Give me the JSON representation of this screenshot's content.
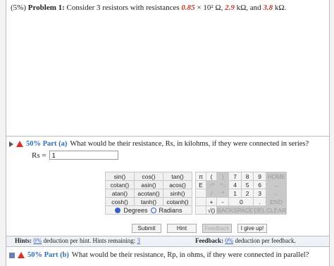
{
  "problem": {
    "weight": "(5%)",
    "label": "Problem 1:",
    "text_pre": "Consider 3 resistors with resistances",
    "r1": "0.85",
    "r1_unit": "× 10² Ω,",
    "r2": "2.9",
    "r2_unit": "kΩ, and",
    "r3": "3.8",
    "r3_unit": "kΩ."
  },
  "part_a": {
    "percent": "50% Part (a)",
    "question": "What would be their resistance, Rs, in kilohms, if they were connected in series?",
    "answer_label": "Rs =",
    "answer_value": "1"
  },
  "keypad": {
    "fn_rows": [
      [
        "sin()",
        "cos()",
        "tan()"
      ],
      [
        "cotan()",
        "asin()",
        "acos()"
      ],
      [
        "atan()",
        "acotan()",
        "sinh()"
      ],
      [
        "cosh()",
        "tanh()",
        "cotanh()"
      ]
    ],
    "side_rows": [
      [
        "π",
        "(",
        ")",
        "7",
        "8",
        "9",
        "HOME"
      ],
      [
        "E",
        "↑^",
        "^↓",
        "4",
        "5",
        "6",
        "←"
      ],
      [
        "",
        "/",
        "*",
        "1",
        "2",
        "3",
        "→"
      ],
      [
        "",
        "+",
        "-",
        "0",
        ".",
        "END"
      ],
      [
        "",
        "√()",
        "BACKSPACE",
        "DEL",
        "CLEAR"
      ]
    ],
    "degrees": "Degrees",
    "radians": "Radians"
  },
  "buttons": {
    "submit": "Submit",
    "hint": "Hint",
    "feedback": "Feedback",
    "give_up": "I give up!"
  },
  "hints_bar": {
    "hints_label": "Hints:",
    "hints_pct": "0%",
    "hints_text": "deduction per hint. Hints remaining:",
    "hints_remaining": "3",
    "feedback_label": "Feedback:",
    "feedback_pct": "0%",
    "feedback_text": "deduction per feedback."
  },
  "part_b": {
    "percent": "50% Part (b)",
    "question": "What would be their resistance, Rp, in ohms, if they were connected in parallel?"
  }
}
